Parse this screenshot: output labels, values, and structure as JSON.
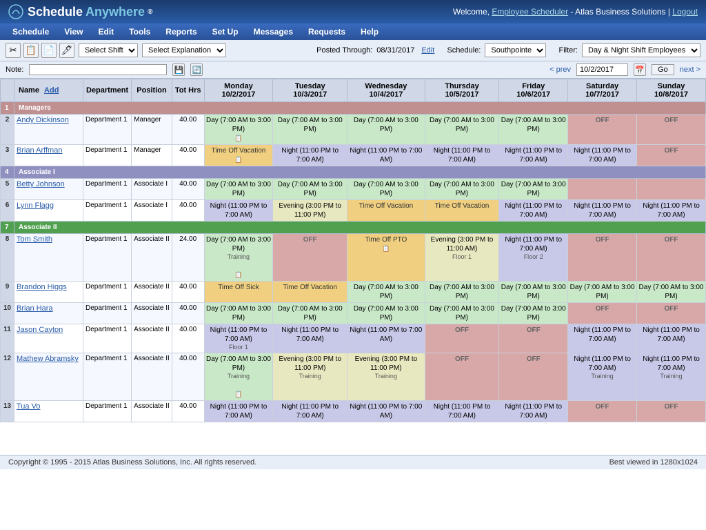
{
  "app": {
    "title": "Schedule Anywhere",
    "title_highlight": "Anywhere",
    "reg_mark": "®"
  },
  "header": {
    "welcome_text": "Welcome,",
    "user_link": "Employee Scheduler",
    "company": "- Atlas Business Solutions |",
    "logout_link": "Logout"
  },
  "nav": {
    "items": [
      "Schedule",
      "View",
      "Edit",
      "Tools",
      "Reports",
      "Set Up",
      "Messages",
      "Requests",
      "Help"
    ]
  },
  "toolbar": {
    "shift_select_placeholder": "Select Shift",
    "explanation_select_placeholder": "Select Explanation",
    "schedule_label": "Schedule:",
    "schedule_value": "Southpointe",
    "filter_label": "Filter:",
    "filter_value": "Day & Night Shift Employees"
  },
  "note_bar": {
    "label": "Note:",
    "placeholder": ""
  },
  "date_nav": {
    "posted_label": "Posted Through:",
    "posted_date": "08/31/2017",
    "edit_link": "Edit",
    "prev_link": "< prev",
    "current_date": "10/2/2017",
    "next_link": "next >",
    "go_button": "Go"
  },
  "table": {
    "columns": [
      "Name",
      "Add",
      "Department",
      "Position",
      "Tot Hrs",
      "Monday\n10/2/2017",
      "Tuesday\n10/3/2017",
      "Wednesday\n10/4/2017",
      "Thursday\n10/5/2017",
      "Friday\n10/6/2017",
      "Saturday\n10/7/2017",
      "Sunday\n10/8/2017"
    ],
    "groups": [
      {
        "id": 1,
        "label": "Managers",
        "class": "group-managers"
      },
      {
        "id": 4,
        "label": "Associate I",
        "class": "group-assoc1"
      },
      {
        "id": 7,
        "label": "Associate II",
        "class": "group-assoc2"
      }
    ],
    "rows": [
      {
        "num": 2,
        "name": "Andy Dickinson",
        "dept": "Department 1",
        "pos": "Manager",
        "hrs": "40.00",
        "mon": {
          "type": "day",
          "text": "Day (7:00 AM to 3:00 PM)",
          "extra": "📋"
        },
        "tue": {
          "type": "day",
          "text": "Day (7:00 AM to 3:00 PM)"
        },
        "wed": {
          "type": "day",
          "text": "Day (7:00 AM to 3:00 PM)"
        },
        "thu": {
          "type": "day",
          "text": "Day (7:00 AM to 3:00 PM)"
        },
        "fri": {
          "type": "day",
          "text": "Day (7:00 AM to 3:00 PM)"
        },
        "sat": {
          "type": "off",
          "text": "OFF"
        },
        "sun": {
          "type": "off",
          "text": "OFF"
        }
      },
      {
        "num": 3,
        "name": "Brian Arffman",
        "dept": "Department 1",
        "pos": "Manager",
        "hrs": "40.00",
        "mon": {
          "type": "timeoff",
          "text": "Time Off Vacation",
          "extra": "📋"
        },
        "tue": {
          "type": "night",
          "text": "Night (11:00 PM to 7:00 AM)"
        },
        "wed": {
          "type": "night",
          "text": "Night (11:00 PM to 7:00 AM)"
        },
        "thu": {
          "type": "night",
          "text": "Night (11:00 PM to 7:00 AM)"
        },
        "fri": {
          "type": "night",
          "text": "Night (11:00 PM to 7:00 AM)"
        },
        "sat": {
          "type": "night",
          "text": "Night (11:00 PM to 7:00 AM)"
        },
        "sun": {
          "type": "off",
          "text": "OFF"
        }
      },
      {
        "num": 5,
        "name": "Betty Johnson",
        "dept": "Department 1",
        "pos": "Associate I",
        "hrs": "40.00",
        "mon": {
          "type": "day",
          "text": "Day (7:00 AM to 3:00 PM)"
        },
        "tue": {
          "type": "day",
          "text": "Day (7:00 AM to 3:00 PM)"
        },
        "wed": {
          "type": "day",
          "text": "Day (7:00 AM to 3:00 PM)"
        },
        "thu": {
          "type": "day",
          "text": "Day (7:00 AM to 3:00 PM)"
        },
        "fri": {
          "type": "day",
          "text": "Day (7:00 AM to 3:00 PM)"
        },
        "sat": {
          "type": "empty",
          "text": ""
        },
        "sun": {
          "type": "empty",
          "text": ""
        }
      },
      {
        "num": 6,
        "name": "Lynn Flagg",
        "dept": "Department 1",
        "pos": "Associate I",
        "hrs": "40.00",
        "mon": {
          "type": "night",
          "text": "Night (11:00 PM to 7:00 AM)"
        },
        "tue": {
          "type": "evening",
          "text": "Evening (3:00 PM to 11:00 PM)"
        },
        "wed": {
          "type": "timeoff",
          "text": "Time Off Vacation"
        },
        "thu": {
          "type": "timeoff",
          "text": "Time Off Vacation"
        },
        "fri": {
          "type": "night",
          "text": "Night (11:00 PM to 7:00 AM)"
        },
        "sat": {
          "type": "night",
          "text": "Night (11:00 PM to 7:00 AM)"
        },
        "sun": {
          "type": "night",
          "text": "Night (11:00 PM to 7:00 AM)"
        }
      },
      {
        "num": 8,
        "name": "Tom Smith",
        "dept": "Department 1",
        "pos": "Associate II",
        "hrs": "24.00",
        "mon": {
          "type": "day",
          "text": "Day (7:00 AM to 3:00 PM) Training",
          "extra": "📋"
        },
        "tue": {
          "type": "off",
          "text": "OFF"
        },
        "wed": {
          "type": "timeoff",
          "text": "Time Off PTO",
          "extra": "📋"
        },
        "thu": {
          "type": "evening",
          "text": "Evening (3:00 PM to 11:00 AM)",
          "note2": "Floor 1"
        },
        "fri": {
          "type": "night",
          "text": "Night (11:00 PM to 7:00 AM)",
          "note2": "Floor 2"
        },
        "sat": {
          "type": "off",
          "text": "OFF"
        },
        "sun": {
          "type": "off",
          "text": "OFF"
        }
      },
      {
        "num": 9,
        "name": "Brandon Higgs",
        "dept": "Department 1",
        "pos": "Associate II",
        "hrs": "40.00",
        "mon": {
          "type": "timeoff",
          "text": "Time Off Sick"
        },
        "tue": {
          "type": "timeoff",
          "text": "Time Off Vacation"
        },
        "wed": {
          "type": "day",
          "text": "Day (7:00 AM to 3:00 PM)"
        },
        "thu": {
          "type": "day",
          "text": "Day (7:00 AM to 3:00 PM)"
        },
        "fri": {
          "type": "day",
          "text": "Day (7:00 AM to 3:00 PM)"
        },
        "sat": {
          "type": "day",
          "text": "Day (7:00 AM to 3:00 PM)"
        },
        "sun": {
          "type": "day",
          "text": "Day (7:00 AM to 3:00 PM)"
        }
      },
      {
        "num": 10,
        "name": "Brian Hara",
        "dept": "Department 1",
        "pos": "Associate II",
        "hrs": "40.00",
        "mon": {
          "type": "day",
          "text": "Day (7:00 AM to 3:00 PM)"
        },
        "tue": {
          "type": "day",
          "text": "Day (7:00 AM to 3:00 PM)"
        },
        "wed": {
          "type": "day",
          "text": "Day (7:00 AM to 3:00 PM)"
        },
        "thu": {
          "type": "day",
          "text": "Day (7:00 AM to 3:00 PM)"
        },
        "fri": {
          "type": "day",
          "text": "Day (7:00 AM to 3:00 PM)"
        },
        "sat": {
          "type": "off",
          "text": "OFF"
        },
        "sun": {
          "type": "off",
          "text": "OFF"
        }
      },
      {
        "num": 11,
        "name": "Jason Cayton",
        "dept": "Department 1",
        "pos": "Associate II",
        "hrs": "40.00",
        "mon": {
          "type": "night",
          "text": "Night (11:00 PM to 7:00 AM)",
          "note2": "Floor 1"
        },
        "tue": {
          "type": "night",
          "text": "Night (11:00 PM to 7:00 AM)"
        },
        "wed": {
          "type": "night",
          "text": "Night (11:00 PM to 7:00 AM)"
        },
        "thu": {
          "type": "off",
          "text": "OFF"
        },
        "fri": {
          "type": "off",
          "text": "OFF"
        },
        "sat": {
          "type": "night",
          "text": "Night (11:00 PM to 7:00 AM)"
        },
        "sun": {
          "type": "night",
          "text": "Night (11:00 PM to 7:00 AM)"
        }
      },
      {
        "num": 12,
        "name": "Mathew Abramsky",
        "dept": "Department 1",
        "pos": "Associate II",
        "hrs": "40.00",
        "mon": {
          "type": "day",
          "text": "Day (7:00 AM to 3:00 PM) Training",
          "extra": "📋"
        },
        "tue": {
          "type": "evening",
          "text": "Evening (3:00 PM to 11:00 PM) Training"
        },
        "wed": {
          "type": "evening",
          "text": "Evening (3:00 PM to 11:00 PM) Training"
        },
        "thu": {
          "type": "off",
          "text": "OFF"
        },
        "fri": {
          "type": "off",
          "text": "OFF"
        },
        "sat": {
          "type": "night",
          "text": "Night (11:00 PM to 7:00 AM) Training"
        },
        "sun": {
          "type": "night",
          "text": "Night (11:00 PM to 7:00 AM) Training"
        }
      },
      {
        "num": 13,
        "name": "Tua Vo",
        "dept": "Department 1",
        "pos": "Associate II",
        "hrs": "40.00",
        "mon": {
          "type": "night",
          "text": "Night (11:00 PM to 7:00 AM)"
        },
        "tue": {
          "type": "night",
          "text": "Night (11:00 PM to 7:00 AM)"
        },
        "wed": {
          "type": "night",
          "text": "Night (11:00 PM to 7:00 AM)"
        },
        "thu": {
          "type": "night",
          "text": "Night (11:00 PM to 7:00 AM)"
        },
        "fri": {
          "type": "night",
          "text": "Night (11:00 PM to 7:00 AM)"
        },
        "sat": {
          "type": "off",
          "text": "OFF"
        },
        "sun": {
          "type": "off",
          "text": "OFF"
        }
      }
    ]
  },
  "footer": {
    "copyright": "Copyright © 1995 - 2015 Atlas Business Solutions, Inc. All rights reserved.",
    "best_viewed": "Best viewed in 1280x1024"
  }
}
